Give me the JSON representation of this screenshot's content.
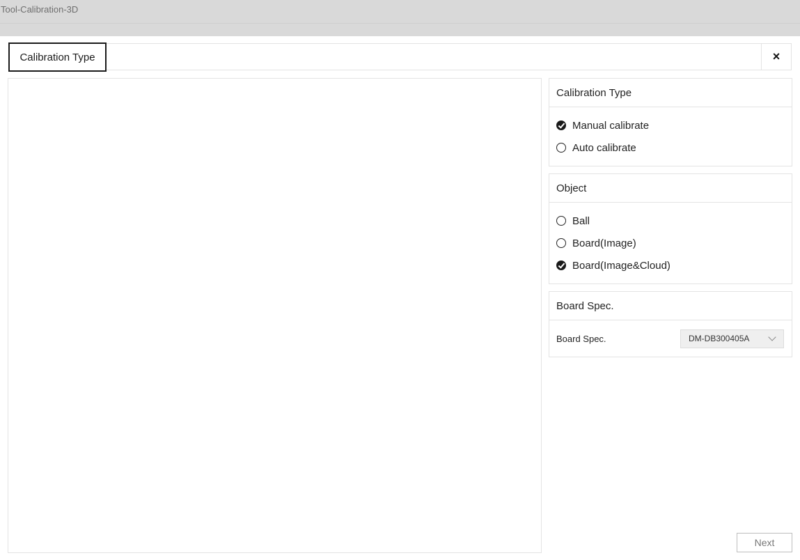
{
  "window": {
    "title": "Tool-Calibration-3D"
  },
  "tabs": {
    "active_label": "Calibration Type",
    "close_symbol": "×"
  },
  "calibration_type": {
    "header": "Calibration Type",
    "options": [
      {
        "label": "Manual calibrate",
        "checked": true
      },
      {
        "label": "Auto calibrate",
        "checked": false
      }
    ]
  },
  "object": {
    "header": "Object",
    "options": [
      {
        "label": "Ball",
        "checked": false
      },
      {
        "label": "Board(Image)",
        "checked": false
      },
      {
        "label": "Board(Image&Cloud)",
        "checked": true
      }
    ]
  },
  "board_spec": {
    "header": "Board Spec.",
    "label": "Board Spec.",
    "selected": "DM-DB300405A"
  },
  "footer": {
    "next_label": "Next"
  },
  "icons": {
    "close": "close-icon",
    "dropdown": "chevron-down-icon",
    "radio_checked": "check-icon"
  }
}
